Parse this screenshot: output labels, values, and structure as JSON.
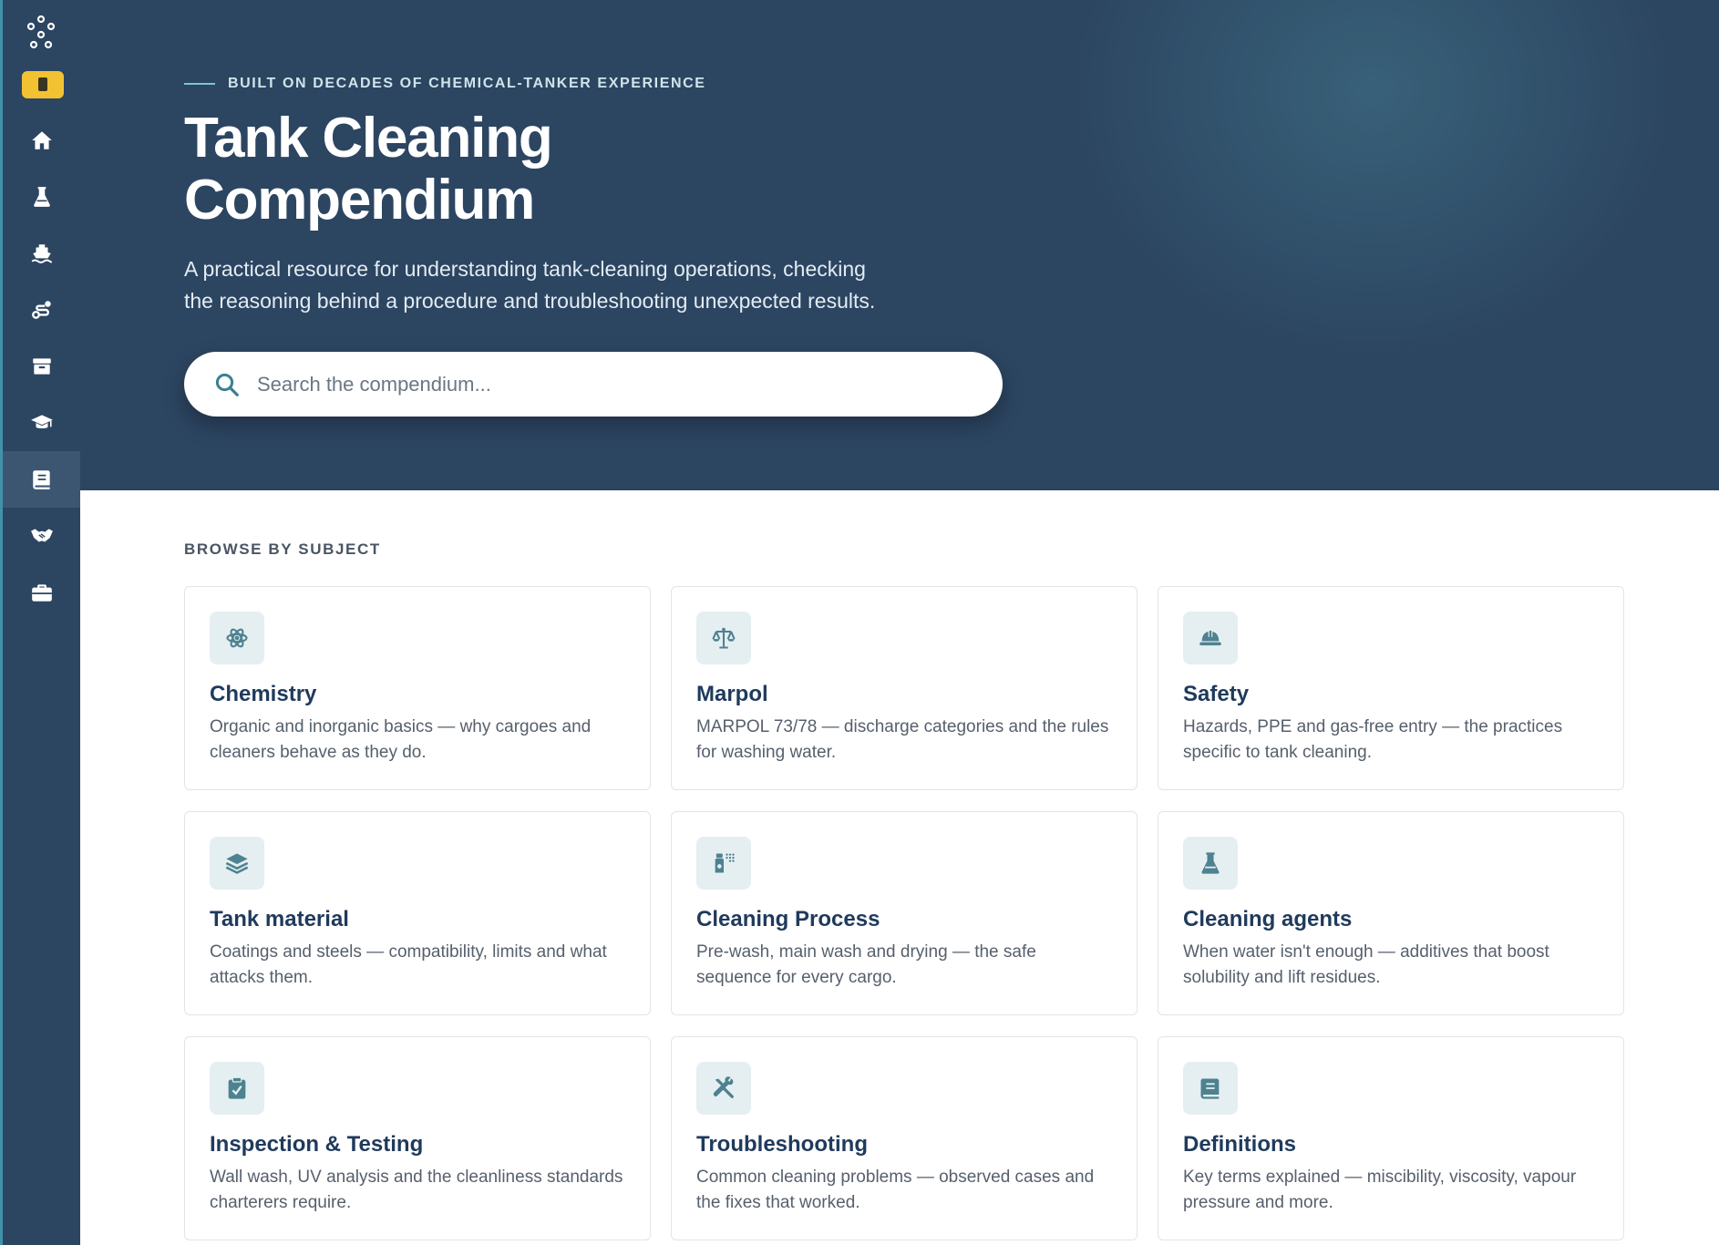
{
  "sidebar": {
    "items": [
      {
        "icon": "home-icon"
      },
      {
        "icon": "flask-icon"
      },
      {
        "icon": "ship-icon"
      },
      {
        "icon": "route-icon"
      },
      {
        "icon": "archive-icon"
      },
      {
        "icon": "graduation-cap-icon"
      },
      {
        "icon": "book-icon",
        "active": true
      },
      {
        "icon": "handshake-icon"
      },
      {
        "icon": "briefcase-icon"
      }
    ]
  },
  "hero": {
    "eyebrow": "BUILT ON DECADES OF CHEMICAL-TANKER EXPERIENCE",
    "title_line1": "Tank Cleaning",
    "title_line2": "Compendium",
    "subtitle_line1": "A practical resource for understanding tank-cleaning operations, checking",
    "subtitle_line2": "the reasoning behind a procedure and troubleshooting unexpected results.",
    "search_placeholder": "Search the compendium..."
  },
  "browse": {
    "label": "BROWSE BY SUBJECT",
    "cards": [
      {
        "title": "Chemistry",
        "description": "Organic and inorganic basics — why cargoes and cleaners behave as they do.",
        "icon": "atom-icon"
      },
      {
        "title": "Marpol",
        "description": "MARPOL 73/78 — discharge categories and the rules for washing water.",
        "icon": "scale-icon"
      },
      {
        "title": "Safety",
        "description": "Hazards, PPE and gas-free entry — the practices specific to tank cleaning.",
        "icon": "hard-hat-icon"
      },
      {
        "title": "Tank material",
        "description": "Coatings and steels — compatibility, limits and what attacks them.",
        "icon": "layers-icon"
      },
      {
        "title": "Cleaning Process",
        "description": "Pre-wash, main wash and drying — the safe sequence for every cargo.",
        "icon": "spray-bottle-icon"
      },
      {
        "title": "Cleaning agents",
        "description": "When water isn't enough — additives that boost solubility and lift residues.",
        "icon": "flask-icon"
      },
      {
        "title": "Inspection & Testing",
        "description": "Wall wash, UV analysis and the cleanliness standards charterers require.",
        "icon": "clipboard-check-icon"
      },
      {
        "title": "Troubleshooting",
        "description": "Common cleaning problems — observed cases and the fixes that worked.",
        "icon": "tools-icon"
      },
      {
        "title": "Definitions",
        "description": "Key terms explained — miscibility, viscosity, vapour pressure and more.",
        "icon": "book-icon"
      }
    ]
  },
  "colors": {
    "sidebar_bg": "#2c4561",
    "hero_bg": "#2c4561",
    "accent": "#3f93a8",
    "badge": "#f2c232",
    "card_title": "#1f3a5c",
    "icon_color": "#4e8290"
  }
}
